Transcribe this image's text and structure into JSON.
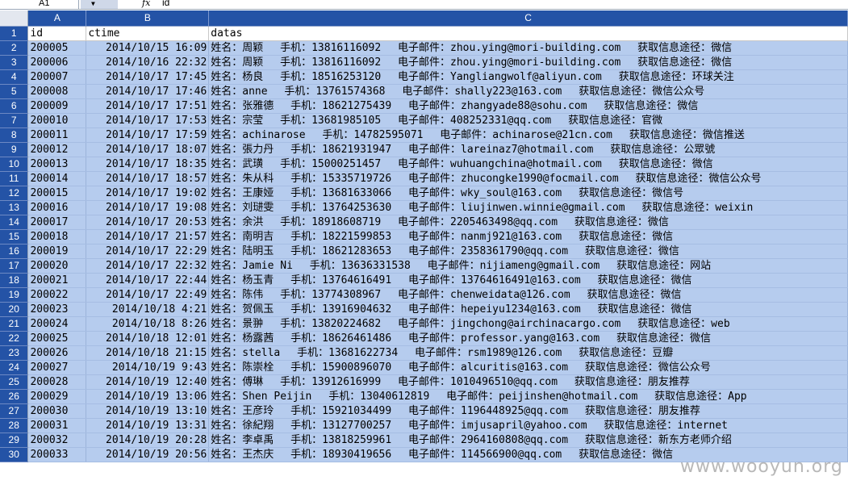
{
  "formula_bar": {
    "cell_ref": "A1",
    "fx_label": "fx",
    "content": "id"
  },
  "columns": [
    "A",
    "B",
    "C"
  ],
  "header_row": {
    "id": "id",
    "ctime": "ctime",
    "datas": "datas"
  },
  "rows": [
    {
      "row": "2",
      "id": "200005",
      "ctime": "2014/10/15 16:09",
      "datas": "姓名：周颖　 手机：13816116092　 电子邮件：zhou.ying@mori-building.com　 获取信息途径：微信"
    },
    {
      "row": "3",
      "id": "200006",
      "ctime": "2014/10/16 22:32",
      "datas": "姓名：周颖　 手机：13816116092　 电子邮件：zhou.ying@mori-building.com　 获取信息途径：微信"
    },
    {
      "row": "4",
      "id": "200007",
      "ctime": "2014/10/17 17:45",
      "datas": "姓名：杨良　 手机：18516253120　 电子邮件：Yangliangwolf@aliyun.com　 获取信息途径：环球关注"
    },
    {
      "row": "5",
      "id": "200008",
      "ctime": "2014/10/17 17:46",
      "datas": "姓名：anne　 手机：13761574368　 电子邮件：shally223@163.com　 获取信息途径：微信公众号"
    },
    {
      "row": "6",
      "id": "200009",
      "ctime": "2014/10/17 17:51",
      "datas": "姓名：张雅德　 手机：18621275439　 电子邮件：zhangyade88@sohu.com　 获取信息途径：微信"
    },
    {
      "row": "7",
      "id": "200010",
      "ctime": "2014/10/17 17:53",
      "datas": "姓名：宗莹　 手机：13681985105　 电子邮件：408252331@qq.com　 获取信息途径：官微"
    },
    {
      "row": "8",
      "id": "200011",
      "ctime": "2014/10/17 17:59",
      "datas": "姓名：achinarose　 手机：14782595071　 电子邮件：achinarose@21cn.com　 获取信息途径：微信推送"
    },
    {
      "row": "9",
      "id": "200012",
      "ctime": "2014/10/17 18:07",
      "datas": "姓名：張力丹　 手机：18621931947　 电子邮件：lareinaz7@hotmail.com　 获取信息途径：公眾號"
    },
    {
      "row": "10",
      "id": "200013",
      "ctime": "2014/10/17 18:35",
      "datas": "姓名：武璜　 手机：15000251457　 电子邮件：wuhuangchina@hotmail.com　 获取信息途径：微信"
    },
    {
      "row": "11",
      "id": "200014",
      "ctime": "2014/10/17 18:57",
      "datas": "姓名：朱从科　 手机：15335719726　 电子邮件：zhucongke1990@focmail.com　 获取信息途径：微信公众号"
    },
    {
      "row": "12",
      "id": "200015",
      "ctime": "2014/10/17 19:02",
      "datas": "姓名：王康娅　 手机：13681633066　 电子邮件：wky_soul@163.com　 获取信息途径：微信号"
    },
    {
      "row": "13",
      "id": "200016",
      "ctime": "2014/10/17 19:08",
      "datas": "姓名：刘琎雯　 手机：13764253630　 电子邮件：liujinwen.winnie@gmail.com　 获取信息途径：weixin"
    },
    {
      "row": "14",
      "id": "200017",
      "ctime": "2014/10/17 20:53",
      "datas": "姓名：余洪　 手机：18918608719　 电子邮件：2205463498@qq.com　 获取信息途径：微信"
    },
    {
      "row": "15",
      "id": "200018",
      "ctime": "2014/10/17 21:57",
      "datas": "姓名：南明吉　 手机：18221599853　 电子邮件：nanmj921@163.com　 获取信息途径：微信"
    },
    {
      "row": "16",
      "id": "200019",
      "ctime": "2014/10/17 22:29",
      "datas": "姓名：陆明玉　 手机：18621283653　 电子邮件：2358361790@qq.com　 获取信息途径：微信"
    },
    {
      "row": "17",
      "id": "200020",
      "ctime": "2014/10/17 22:32",
      "datas": "姓名：Jamie Ni　 手机：13636331538　 电子邮件：nijiameng@gmail.com　 获取信息途径：网站"
    },
    {
      "row": "18",
      "id": "200021",
      "ctime": "2014/10/17 22:44",
      "datas": "姓名：杨玉青　 手机：13764616491　 电子邮件：13764616491@163.com　 获取信息途径：微信"
    },
    {
      "row": "19",
      "id": "200022",
      "ctime": "2014/10/17 22:49",
      "datas": "姓名：陈伟　 手机：13774308967　 电子邮件：chenweidata@126.com　 获取信息途径：微信"
    },
    {
      "row": "20",
      "id": "200023",
      "ctime": "2014/10/18 4:21",
      "datas": "姓名：贺佩玉　 手机：13916904632　 电子邮件：hepeiyu1234@163.com　 获取信息途径：微信"
    },
    {
      "row": "21",
      "id": "200024",
      "ctime": "2014/10/18 8:26",
      "datas": "姓名：景翀　 手机：13820224682　 电子邮件：jingchong@airchinacargo.com　 获取信息途径：web"
    },
    {
      "row": "22",
      "id": "200025",
      "ctime": "2014/10/18 12:01",
      "datas": "姓名：杨露茜　 手机：18626461486　 电子邮件：professor.yang@163.com　 获取信息途径：微信"
    },
    {
      "row": "23",
      "id": "200026",
      "ctime": "2014/10/18 21:15",
      "datas": "姓名：stella　 手机：13681622734　 电子邮件：rsm1989@126.com　 获取信息途径：豆瓣"
    },
    {
      "row": "24",
      "id": "200027",
      "ctime": "2014/10/19 9:43",
      "datas": "姓名：陈崇栓　 手机：15900896070　 电子邮件：alcuritis@163.com　 获取信息途径：微信公众号"
    },
    {
      "row": "25",
      "id": "200028",
      "ctime": "2014/10/19 12:40",
      "datas": "姓名：傅琳　 手机：13912616999　 电子邮件：1010496510@qq.com　 获取信息途径：朋友推荐"
    },
    {
      "row": "26",
      "id": "200029",
      "ctime": "2014/10/19 13:06",
      "datas": "姓名：Shen Peijin　 手机：13040612819　 电子邮件：peijinshen@hotmail.com　 获取信息途径：App"
    },
    {
      "row": "27",
      "id": "200030",
      "ctime": "2014/10/19 13:10",
      "datas": "姓名：王彦玲　 手机：15921034499　 电子邮件：1196448925@qq.com　 获取信息途径：朋友推荐"
    },
    {
      "row": "28",
      "id": "200031",
      "ctime": "2014/10/19 13:31",
      "datas": "姓名：徐紀翔　 手机：13127700257　 电子邮件：imjusapril@yahoo.com　 获取信息途径：internet"
    },
    {
      "row": "29",
      "id": "200032",
      "ctime": "2014/10/19 20:28",
      "datas": "姓名：李卓禹　 手机：13818259961　 电子邮件：2964160808@qq.com　 获取信息途径：新东方老师介绍"
    },
    {
      "row": "30",
      "id": "200033",
      "ctime": "2014/10/19 20:56",
      "datas": "姓名：王杰庆　 手机：18930419656　 电子邮件：114566900@qq.com　 获取信息途径：微信"
    }
  ],
  "watermark": "www.wooyun.org"
}
